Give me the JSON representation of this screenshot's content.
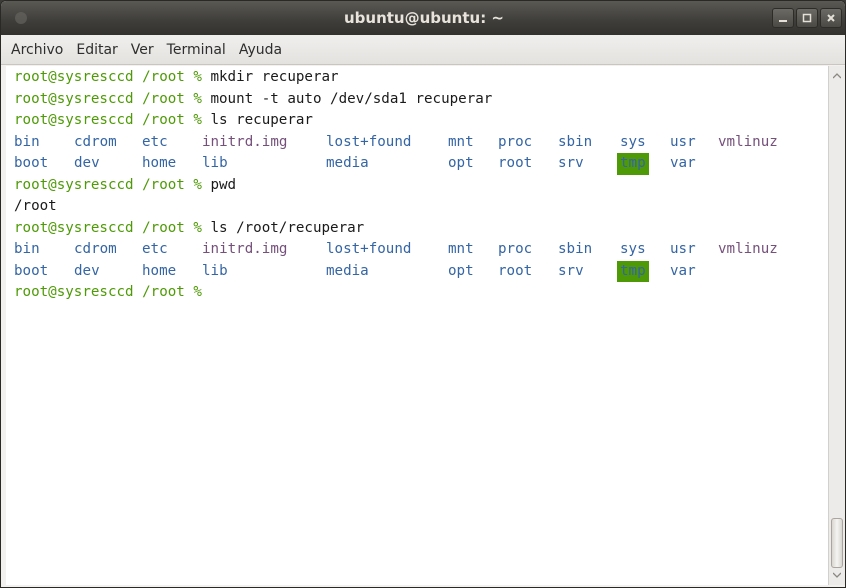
{
  "window": {
    "title": "ubuntu@ubuntu: ~",
    "buttons": {
      "minimize": "_",
      "maximize": "□",
      "close": "x"
    }
  },
  "menubar": {
    "items": [
      "Archivo",
      "Editar",
      "Ver",
      "Terminal",
      "Ayuda"
    ]
  },
  "terminal": {
    "lines": [
      {
        "prompt": "root@sysresccd /root % ",
        "cmd": "mkdir recuperar"
      },
      {
        "prompt": "root@sysresccd /root % ",
        "cmd": "mount -t auto /dev/sda1 recuperar"
      },
      {
        "prompt": "root@sysresccd /root % ",
        "cmd": "ls recuperar"
      }
    ],
    "ls1": {
      "row1": [
        "bin",
        "cdrom",
        "etc",
        "initrd.img",
        "lost+found",
        "mnt",
        "proc",
        "sbin",
        "sys",
        "usr",
        "vmlinuz"
      ],
      "row2": [
        "boot",
        "dev",
        "home",
        "lib",
        "media",
        "opt",
        "root",
        "srv",
        "tmp",
        "var"
      ]
    },
    "pwd_line": {
      "prompt": "root@sysresccd /root % ",
      "cmd": "pwd"
    },
    "pwd_output": "/root",
    "ls2_line": {
      "prompt": "root@sysresccd /root % ",
      "cmd": "ls /root/recuperar"
    },
    "ls2": {
      "row1": [
        "bin",
        "cdrom",
        "etc",
        "initrd.img",
        "lost+found",
        "mnt",
        "proc",
        "sbin",
        "sys",
        "usr",
        "vmlinuz"
      ],
      "row2": [
        "boot",
        "dev",
        "home",
        "lib",
        "media",
        "opt",
        "root",
        "srv",
        "tmp",
        "var"
      ]
    },
    "final_prompt": "root@sysresccd /root % "
  },
  "colors": {
    "prompt": "#4e9a06",
    "directory": "#3465a4",
    "symlink": "#06989a",
    "sticky_dir_bg": "#4e9a06"
  }
}
